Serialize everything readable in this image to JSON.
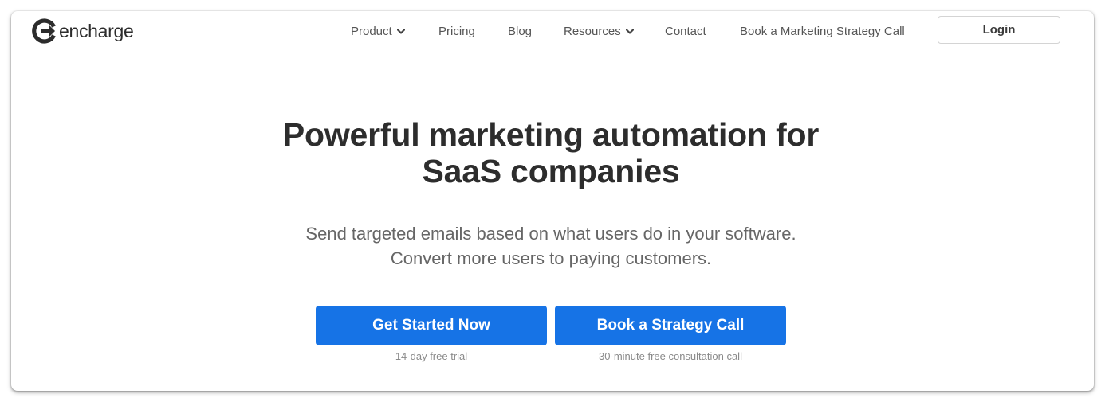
{
  "nav": {
    "logo_text": "encharge",
    "items": [
      {
        "label": "Product",
        "has_dropdown": true
      },
      {
        "label": "Pricing",
        "has_dropdown": false
      },
      {
        "label": "Blog",
        "has_dropdown": false
      },
      {
        "label": "Resources",
        "has_dropdown": true
      },
      {
        "label": "Contact",
        "has_dropdown": false
      },
      {
        "label": "Book a Marketing Strategy Call",
        "has_dropdown": false
      }
    ],
    "login_label": "Login"
  },
  "hero": {
    "title_line1": "Powerful marketing automation for",
    "title_line2": "SaaS companies",
    "subtitle_line1": "Send targeted emails based on what users do in your software.",
    "subtitle_line2": "Convert more users to paying customers."
  },
  "cta": {
    "primary_label": "Get Started Now",
    "primary_note": "14-day free trial",
    "secondary_label": "Book a Strategy Call",
    "secondary_note": "30-minute free consultation call"
  },
  "colors": {
    "accent": "#1673e6",
    "heading": "#2d2d2d",
    "body": "#666666",
    "nav_text": "#555555"
  },
  "icons": {
    "logo": "encharge-logo-icon",
    "dropdown": "chevron-down-icon"
  }
}
